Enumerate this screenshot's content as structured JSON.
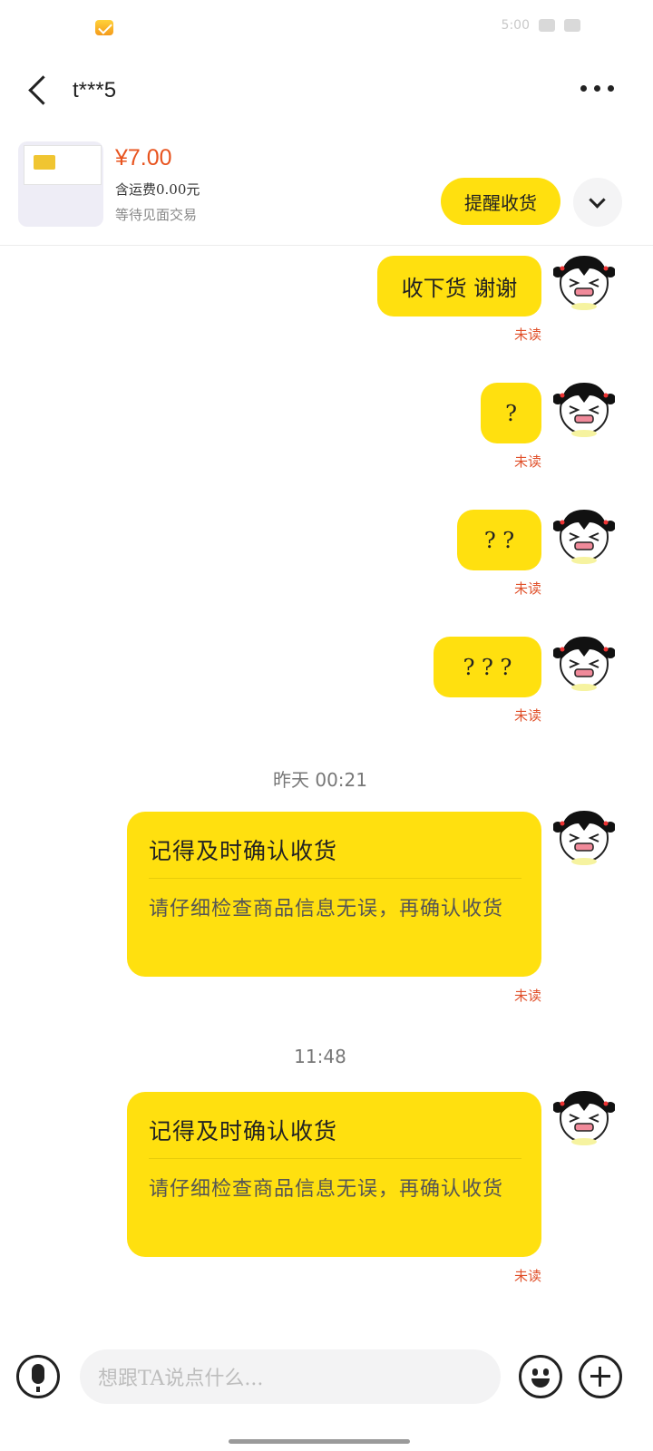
{
  "status_bar": {
    "time_text": "5:00"
  },
  "header": {
    "title": "t***5"
  },
  "product": {
    "price": "¥7.00",
    "shipping": "含运费0.00元",
    "trade_status": "等待见面交易",
    "remind_button": "提醒收货"
  },
  "messages": [
    {
      "text": "收下货 谢谢",
      "status": "未读"
    },
    {
      "text": "?",
      "status": "未读"
    },
    {
      "text": "? ?",
      "status": "未读"
    },
    {
      "text": "? ? ?",
      "status": "未读"
    }
  ],
  "timestamps": [
    "昨天 00:21",
    "11:48"
  ],
  "cards": [
    {
      "title": "记得及时确认收货",
      "body": "请仔细检查商品信息无误，再确认收货",
      "status": "未读"
    },
    {
      "title": "记得及时确认收货",
      "body": "请仔细检查商品信息无误，再确认收货",
      "status": "未读"
    }
  ],
  "input": {
    "placeholder": "想跟TA说点什么..."
  },
  "colors": {
    "accent": "#ffe00f",
    "price": "#e8541f",
    "unread": "#e0502a"
  },
  "icons": [
    "mail-icon",
    "back-icon",
    "more-icon",
    "chevron-down-icon",
    "mic-icon",
    "emoji-icon",
    "plus-icon"
  ]
}
